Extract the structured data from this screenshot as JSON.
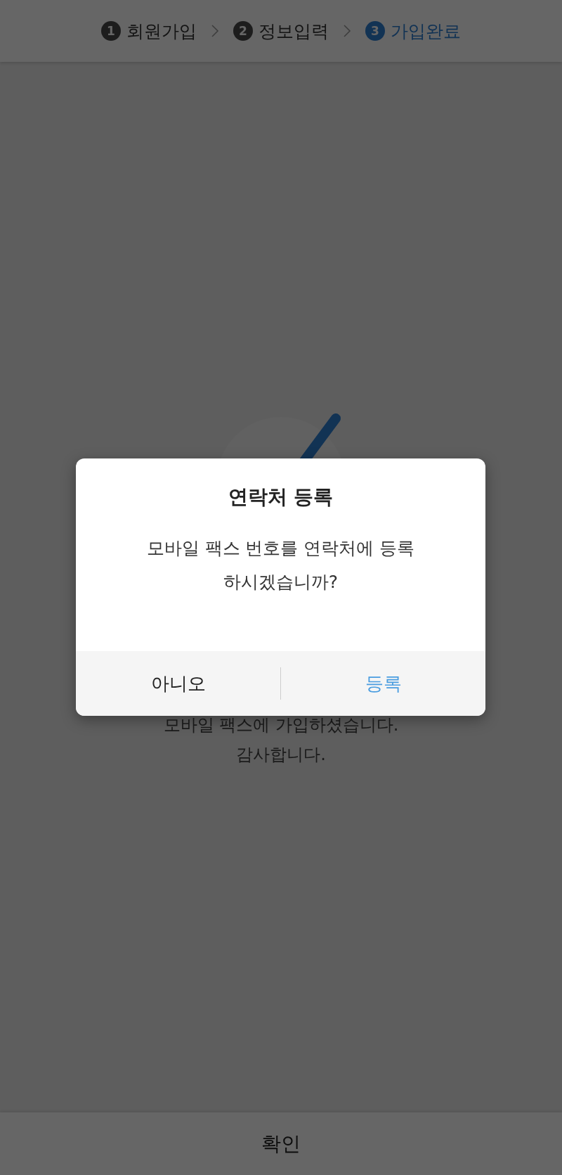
{
  "steps": [
    {
      "number": "1",
      "label": "회원가입",
      "selected": false
    },
    {
      "number": "2",
      "label": "정보입력",
      "selected": false
    },
    {
      "number": "3",
      "label": "가입완료",
      "selected": true
    }
  ],
  "message": [
    "모바일 팩스에 가입하셨습니다.",
    "감사합니다."
  ],
  "confirm_button": "확인",
  "dialog": {
    "title": "연락처 등록",
    "message": "모바일 팩스 번호를 연락처에 등록\n하시겠습니까?",
    "buttons": [
      {
        "label": "아니오",
        "kind": "cancel"
      },
      {
        "label": "등록",
        "kind": "primary"
      }
    ]
  }
}
